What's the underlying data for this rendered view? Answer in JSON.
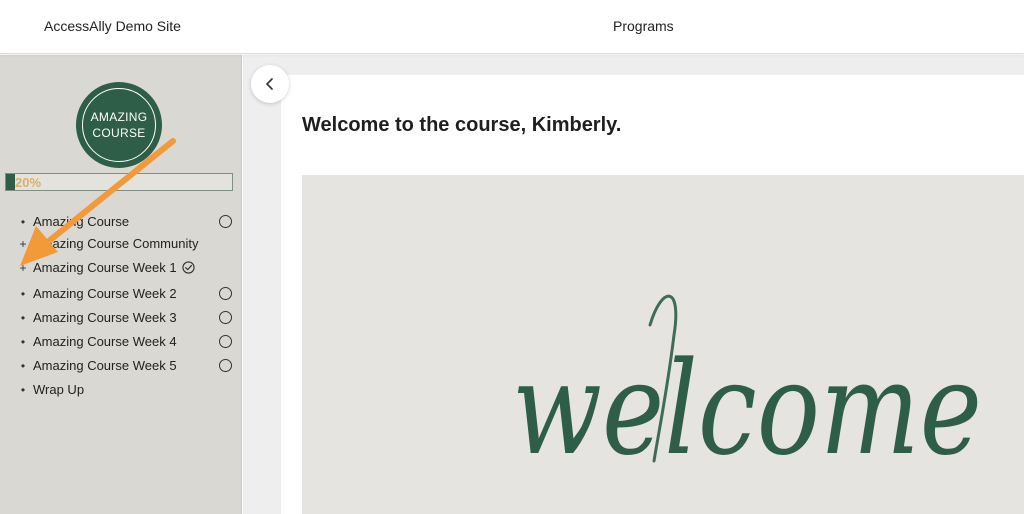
{
  "header": {
    "site_title": "AccessAlly Demo Site",
    "nav_programs": "Programs"
  },
  "sidebar": {
    "logo_lines": [
      "AMAZING",
      "COURSE"
    ],
    "progress": {
      "percent_label": "20%",
      "value": 0.2
    },
    "items": [
      {
        "label": "Amazing Course",
        "marker": "•",
        "status": "incomplete"
      },
      {
        "label": "Amazing Course Community",
        "marker": "+",
        "status": "none"
      },
      {
        "label": "Amazing Course Week 1",
        "marker": "+",
        "status": "complete"
      },
      {
        "label": "Amazing Course Week 2",
        "marker": "•",
        "status": "incomplete"
      },
      {
        "label": "Amazing Course Week 3",
        "marker": "•",
        "status": "incomplete"
      },
      {
        "label": "Amazing Course Week 4",
        "marker": "•",
        "status": "incomplete"
      },
      {
        "label": "Amazing Course Week 5",
        "marker": "•",
        "status": "incomplete"
      },
      {
        "label": "Wrap Up",
        "marker": "•",
        "status": "none"
      }
    ]
  },
  "main": {
    "heading": "Welcome to the course, Kimberly.",
    "image_text": "welcome"
  },
  "colors": {
    "brand_green": "#2e5e47",
    "progress_text": "#d6b36a",
    "sidebar_bg": "#dad8d2",
    "annotation_arrow": "#f2993a"
  },
  "icons": {
    "collapse": "chevron-left-icon",
    "incomplete": "circle-icon",
    "complete": "check-circle-icon"
  }
}
